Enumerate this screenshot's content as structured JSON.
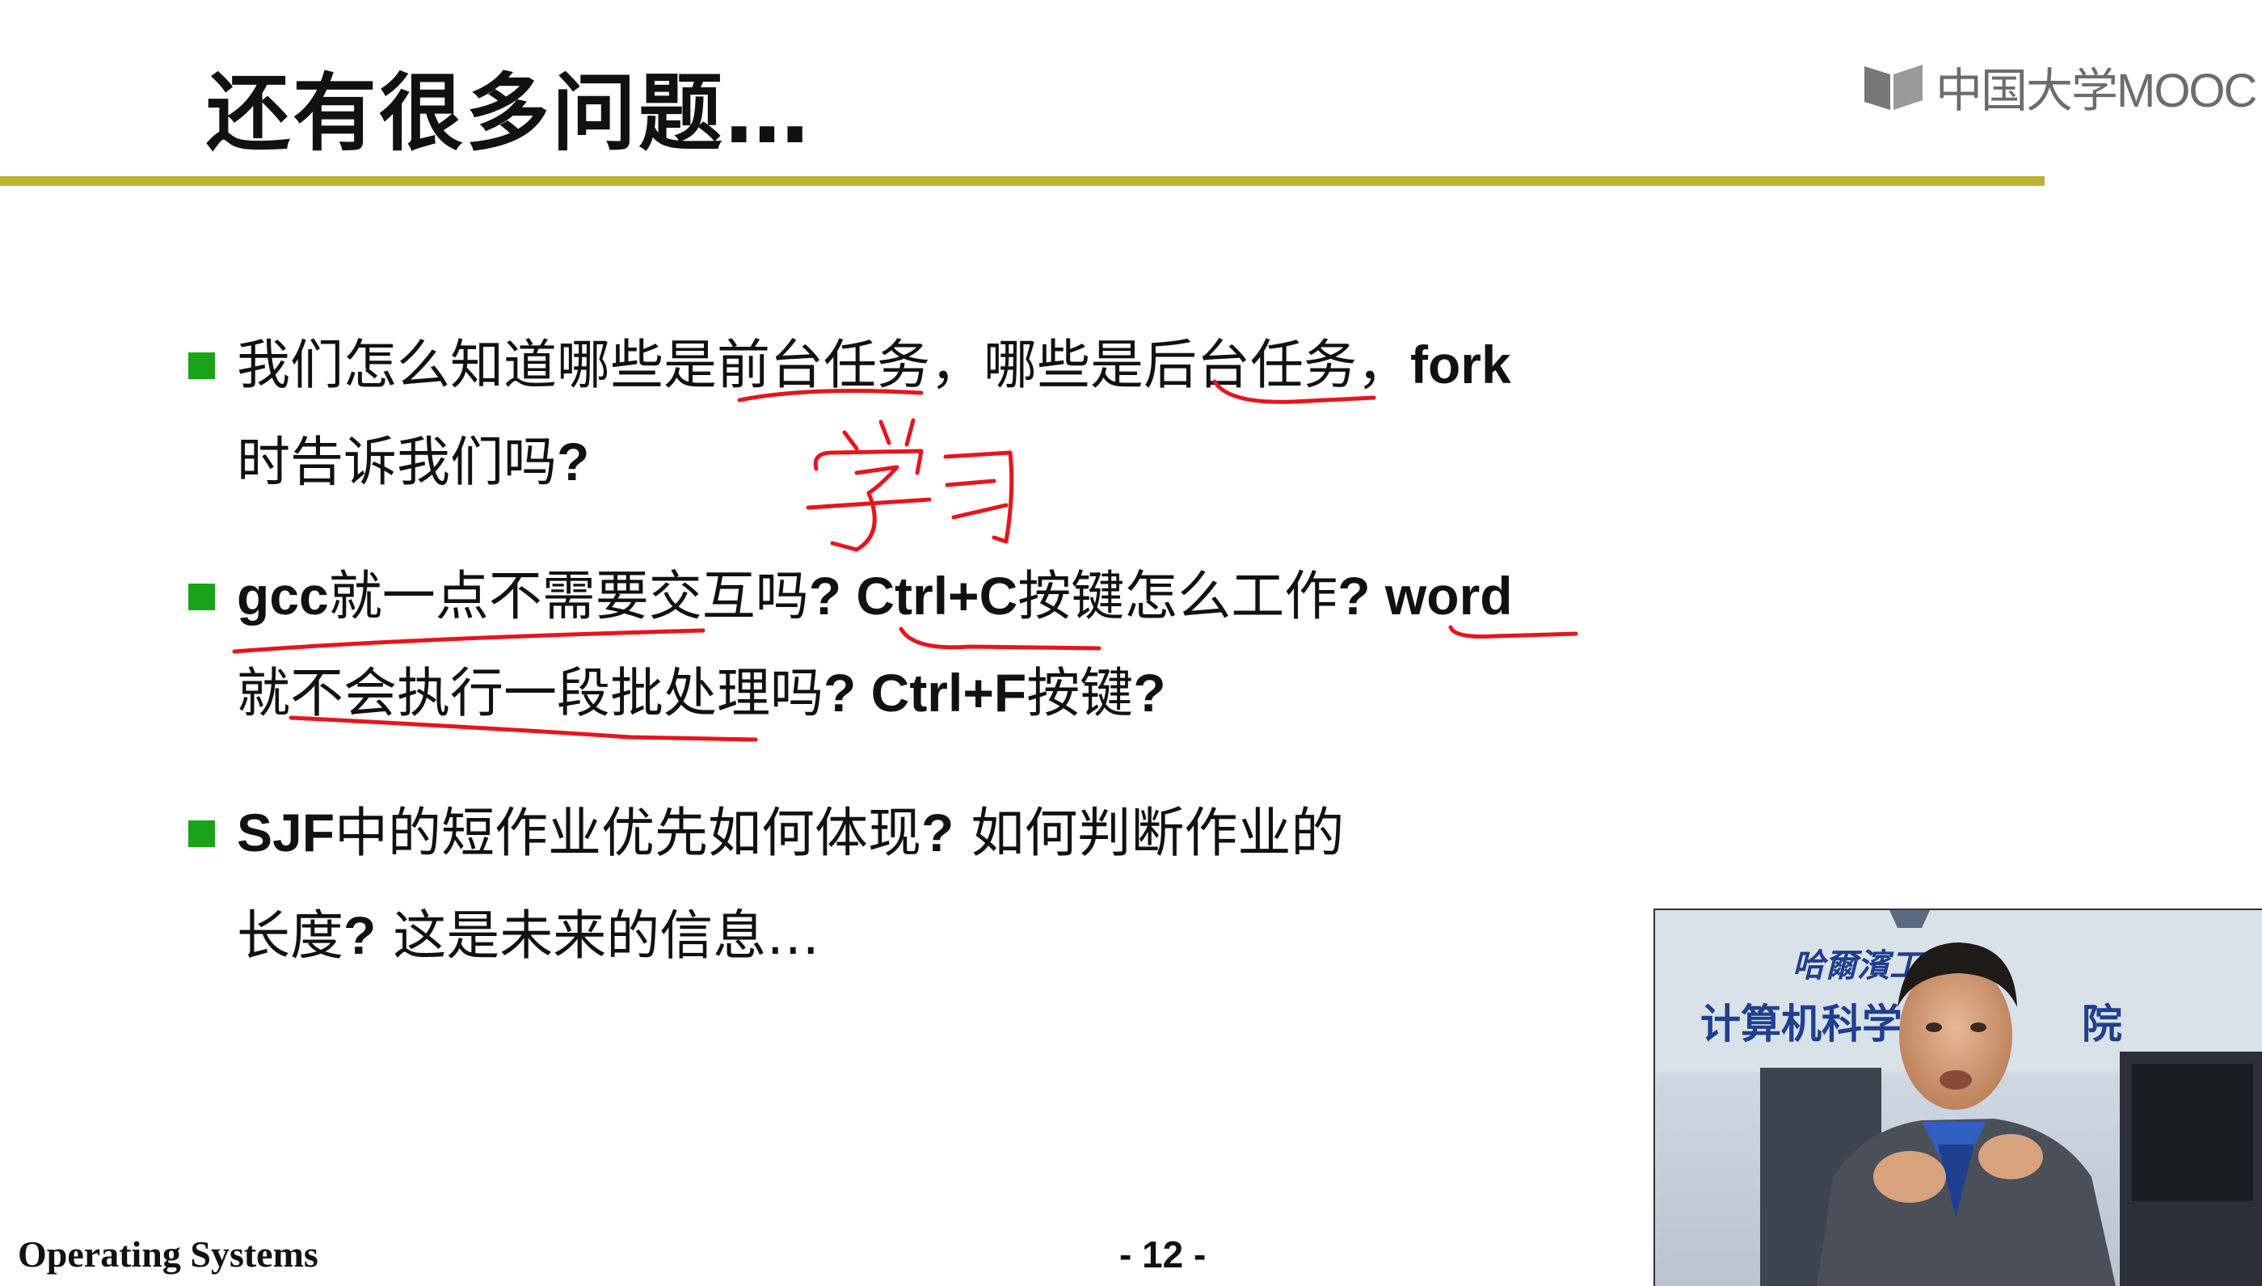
{
  "slide": {
    "title": "还有很多问题…",
    "logo_text": "中国大学MOOC",
    "bullets": [
      {
        "line1": {
          "a": "我们怎么知道哪些是前台任务，哪些是后台任务，",
          "b": "fork"
        },
        "line2": {
          "a": "时告诉我们吗",
          "b": "?"
        }
      },
      {
        "line1": {
          "a": "gcc",
          "b": "就一点不需要交互吗",
          "c": "? Ctrl+C",
          "d": "按键怎么工作",
          "e": "? word"
        },
        "line2": {
          "a": "就不会执行一段批处理吗",
          "b": "? Ctrl+F",
          "c": "按键",
          "d": "?"
        }
      },
      {
        "line1": {
          "a": "SJF",
          "b": "中的短作业优先如何体现",
          "c": "?",
          "d": " 如何判断作业的"
        },
        "line2": {
          "a": "长度",
          "b": "?",
          "c": " 这是未来的信息…"
        }
      }
    ],
    "footer_left": "Operating Systems",
    "page_number": "- 12 -"
  },
  "webcam": {
    "wall_text_top": "哈爾濱工業大",
    "wall_text_main": "计算机科学与技",
    "wall_text_tail": "院"
  },
  "annotations": {
    "handwriting": "学习"
  },
  "colors": {
    "rule": "#b8b42e",
    "bullet": "#19a319",
    "ink": "#e8141c",
    "wall_text": "#1f3f8f"
  }
}
